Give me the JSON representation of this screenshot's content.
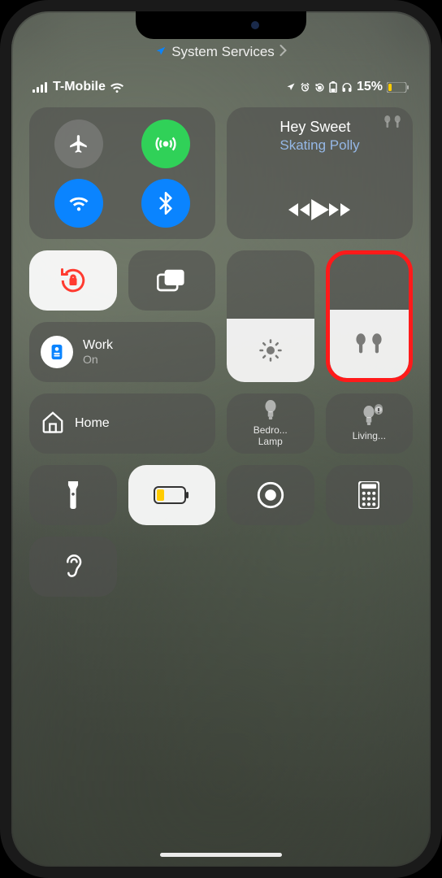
{
  "breadcrumb": {
    "label": "System Services"
  },
  "statusbar": {
    "carrier": "T-Mobile",
    "battery_pct": "15%"
  },
  "connectivity": {
    "airplane": false,
    "cellular": true,
    "wifi": true,
    "bluetooth": true
  },
  "media": {
    "title": "Hey Sweet",
    "artist": "Skating Polly",
    "output": "airpods"
  },
  "sliders": {
    "brightness": 48,
    "volume": 55,
    "volume_device_icon": "airpods"
  },
  "focus": {
    "name": "Work",
    "status": "On"
  },
  "home": {
    "label": "Home",
    "accessories": [
      {
        "name": "Bedro...",
        "line2": "Lamp",
        "on": false
      },
      {
        "name": "Living...",
        "line2": "",
        "on": false,
        "offline": true
      }
    ]
  },
  "rotation_lock": true,
  "low_power": {
    "active": true,
    "pct": 25
  }
}
